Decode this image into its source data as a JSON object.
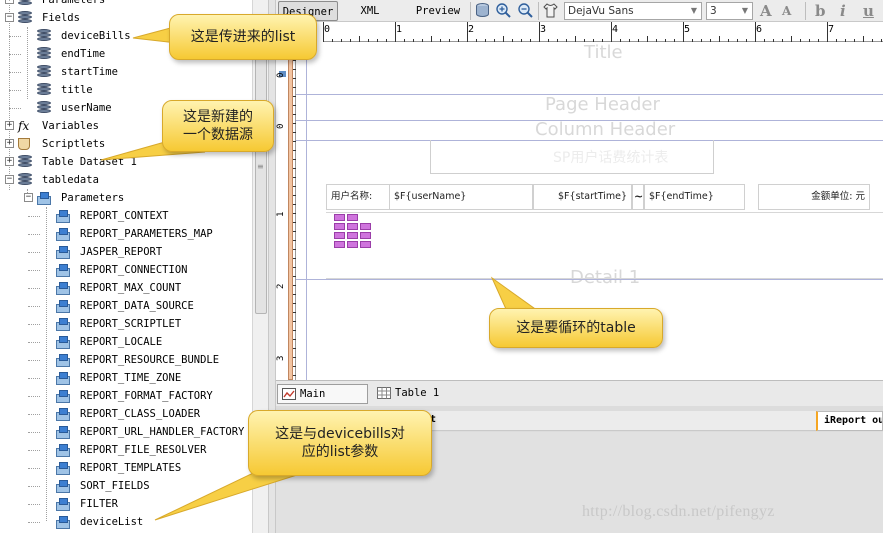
{
  "tree": {
    "items": [
      {
        "label": "Parameters",
        "indent": 0
      },
      {
        "label": "Fields",
        "indent": 0
      },
      {
        "label": "deviceBills",
        "indent": 1
      },
      {
        "label": "endTime",
        "indent": 1
      },
      {
        "label": "startTime",
        "indent": 1
      },
      {
        "label": "title",
        "indent": 1
      },
      {
        "label": "userName",
        "indent": 1
      },
      {
        "label": "Variables",
        "indent": 0
      },
      {
        "label": "Scriptlets",
        "indent": 0
      },
      {
        "label": "Table Dataset 1",
        "indent": 0
      },
      {
        "label": "tabledata",
        "indent": 0
      },
      {
        "label": "Parameters",
        "indent": 1
      },
      {
        "label": "REPORT_CONTEXT",
        "indent": 2
      },
      {
        "label": "REPORT_PARAMETERS_MAP",
        "indent": 2
      },
      {
        "label": "JASPER_REPORT",
        "indent": 2
      },
      {
        "label": "REPORT_CONNECTION",
        "indent": 2
      },
      {
        "label": "REPORT_MAX_COUNT",
        "indent": 2
      },
      {
        "label": "REPORT_DATA_SOURCE",
        "indent": 2
      },
      {
        "label": "REPORT_SCRIPTLET",
        "indent": 2
      },
      {
        "label": "REPORT_LOCALE",
        "indent": 2
      },
      {
        "label": "REPORT_RESOURCE_BUNDLE",
        "indent": 2
      },
      {
        "label": "REPORT_TIME_ZONE",
        "indent": 2
      },
      {
        "label": "REPORT_FORMAT_FACTORY",
        "indent": 2
      },
      {
        "label": "REPORT_CLASS_LOADER",
        "indent": 2
      },
      {
        "label": "REPORT_URL_HANDLER_FACTORY",
        "indent": 2
      },
      {
        "label": "REPORT_FILE_RESOLVER",
        "indent": 2
      },
      {
        "label": "REPORT_TEMPLATES",
        "indent": 2
      },
      {
        "label": "SORT_FIELDS",
        "indent": 2
      },
      {
        "label": "FILTER",
        "indent": 2
      },
      {
        "label": "deviceList",
        "indent": 2
      }
    ]
  },
  "toolbar": {
    "designer_label": "Designer",
    "xml_label": "XML",
    "preview_label": "Preview",
    "font_family_value": "DejaVu Sans",
    "font_size_value": "3",
    "grow_font_label": "A",
    "shrink_font_label": "A",
    "bold_label": "b",
    "italic_label": "i",
    "underline_label": "u"
  },
  "ruler": {
    "h_numbers": [
      "0",
      "1",
      "2",
      "3",
      "4",
      "5",
      "6",
      "7"
    ],
    "v_numbers": [
      "0",
      "0",
      "1",
      "2",
      "3"
    ]
  },
  "report": {
    "title_band": "Title",
    "page_header_band": "Page Header",
    "column_header_band": "Column Header",
    "column_header_hidden_text": "SP用户话费统计表",
    "detail_band": "Detail 1",
    "fields": {
      "user_label": "用户名称:",
      "user_expr": "$F{userName}",
      "start_expr": "$F{startTime}",
      "tilde": "~",
      "end_expr": "$F{endTime}",
      "unit_label": "金额单位: 元"
    }
  },
  "tabs": {
    "main_report": "Main report",
    "table_1": "Table 1"
  },
  "bottom_panel": {
    "tab_label": "iReport output",
    "left_fragment": "ut"
  },
  "callouts": {
    "passed_list": "这是传进来的list",
    "new_datasource": "这是新建的\n一个数据源",
    "loop_table": "这是要循环的table",
    "list_param": "这是与devicebills对\n应的list参数"
  },
  "watermark": "http://blog.csdn.net/pifengyz",
  "colors": {
    "callout_fill": "#f9d24c",
    "band_line": "#aeb3d9",
    "band_label": "#d8d8d8",
    "table_icon": "#cf74dd"
  }
}
